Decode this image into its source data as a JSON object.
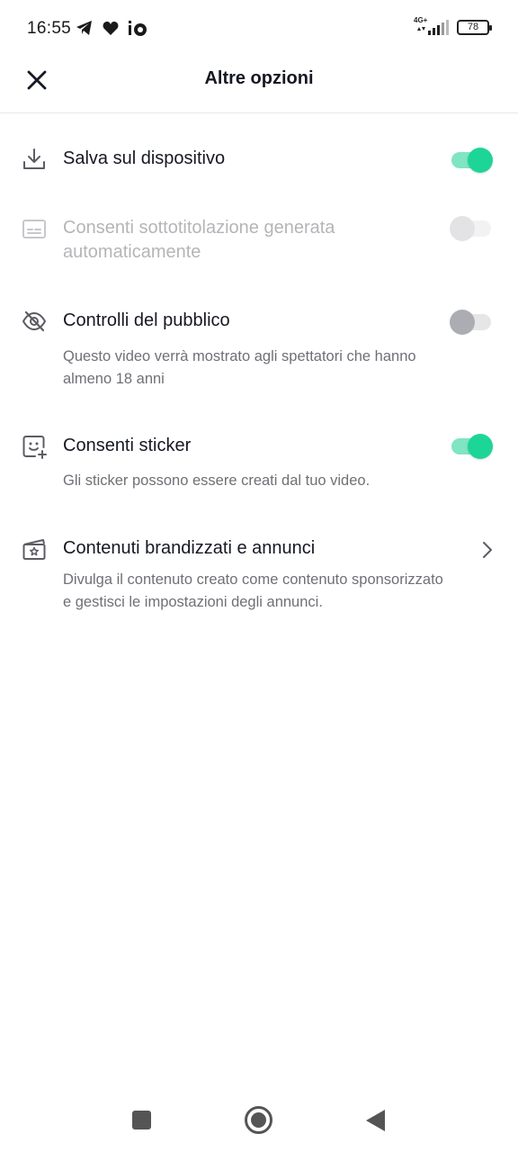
{
  "status_bar": {
    "time": "16:55",
    "network": "4G+",
    "battery": "78"
  },
  "header": {
    "title": "Altre opzioni"
  },
  "settings": [
    {
      "title": "Salva sul dispositivo",
      "icon": "download-icon",
      "toggle": "on"
    },
    {
      "title_line1": "Consenti sottotitolazione generata",
      "title_line2": "automaticamente",
      "icon": "subtitles-icon",
      "toggle": "disabled"
    },
    {
      "title": "Controlli del pubblico",
      "icon": "eye-off-icon",
      "toggle": "off",
      "desc_line1": "Questo video verrà mostrato agli spettatori che hanno",
      "desc_line2": "almeno 18 anni"
    },
    {
      "title": "Consenti sticker",
      "icon": "sticker-add-icon",
      "toggle": "on",
      "desc_line1": "Gli sticker possono essere creati dal tuo video."
    },
    {
      "title": "Contenuti brandizzati e annunci",
      "icon": "branded-content-icon",
      "desc_line1": "Divulga il contenuto creato come contenuto sponsorizzato",
      "desc_line2": "e gestisci le impostazioni degli annunci."
    }
  ],
  "colors": {
    "accent": "#1ed598",
    "accent_track": "#7fe5c2",
    "text_primary": "#161823",
    "text_secondary": "#6f7076",
    "text_disabled": "#b4b5b8"
  }
}
